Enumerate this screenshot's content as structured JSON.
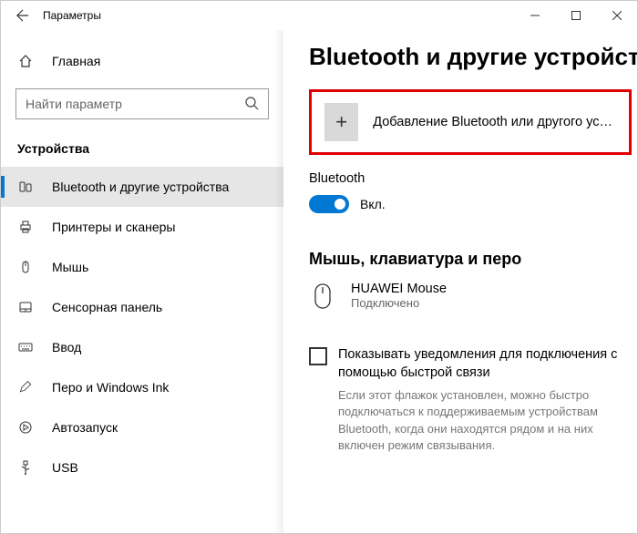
{
  "titlebar": {
    "title": "Параметры"
  },
  "sidebar": {
    "home": "Главная",
    "search_placeholder": "Найти параметр",
    "section": "Устройства",
    "items": [
      {
        "label": "Bluetooth и другие устройства",
        "active": true
      },
      {
        "label": "Принтеры и сканеры"
      },
      {
        "label": "Мышь"
      },
      {
        "label": "Сенсорная панель"
      },
      {
        "label": "Ввод"
      },
      {
        "label": "Перо и Windows Ink"
      },
      {
        "label": "Автозапуск"
      },
      {
        "label": "USB"
      }
    ]
  },
  "content": {
    "page_title": "Bluetooth и другие устройства",
    "add_device_label": "Добавление Bluetooth или другого устройс…",
    "bluetooth_label": "Bluetooth",
    "toggle_label": "Вкл.",
    "section2": "Мышь, клавиатура и перо",
    "device": {
      "name": "HUAWEI  Mouse",
      "status": "Подключено"
    },
    "checkbox_label": "Показывать уведомления для подключения с помощью быстрой связи",
    "helper": "Если этот флажок установлен, можно быстро подключаться к поддерживаемым устройствам Bluetooth, когда они находятся рядом и на них включен режим связывания."
  }
}
